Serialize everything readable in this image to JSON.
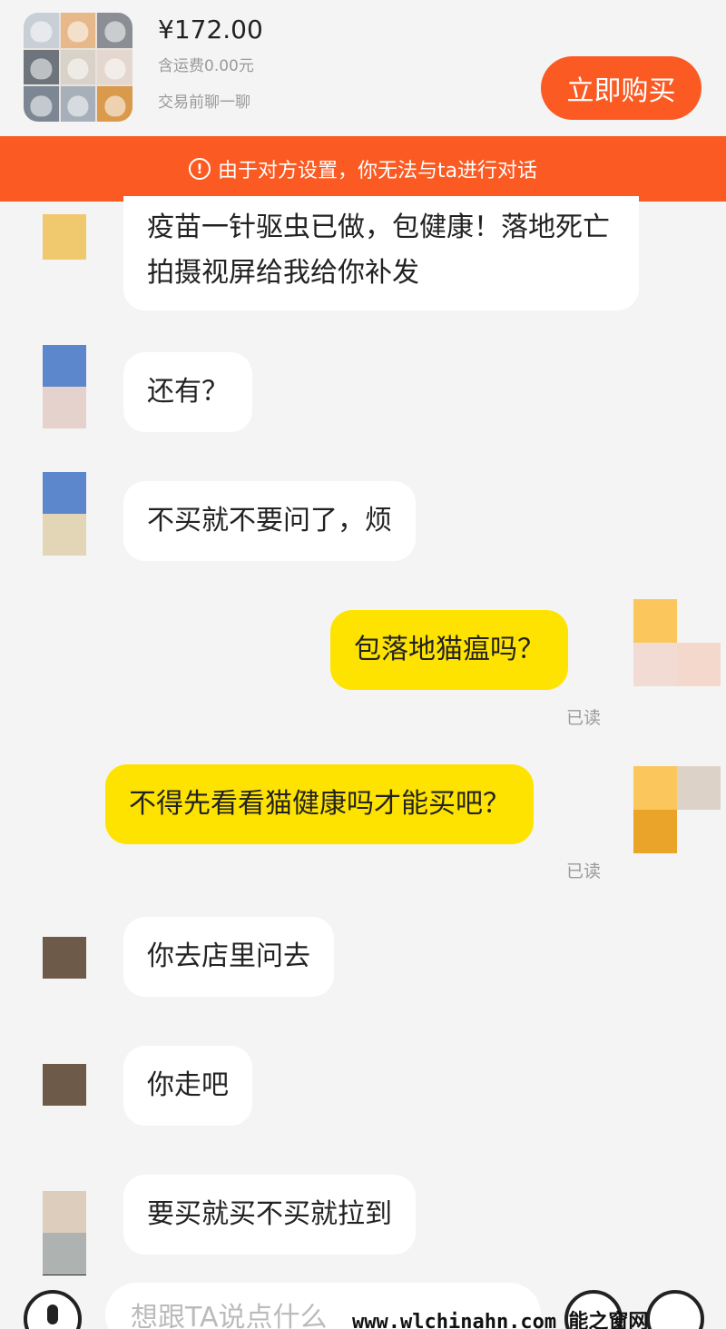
{
  "header": {
    "price": "¥172.00",
    "shipping": "含运费0.00元",
    "chat_note": "交易前聊一聊",
    "buy_label": "立即购买"
  },
  "banner": {
    "icon": "!",
    "text": "由于对方设置，你无法与ta进行对话"
  },
  "messages": [
    {
      "side": "left",
      "text": "疫苗一针驱虫已做，包健康！落地死亡拍摄视屏给我给你补发"
    },
    {
      "side": "left",
      "text": "还有？"
    },
    {
      "side": "left",
      "text": "不买就不要问了，烦"
    },
    {
      "side": "right",
      "text": "包落地猫瘟吗？",
      "status": "已读"
    },
    {
      "side": "right",
      "text": "不得先看看猫健康吗才能买吧？",
      "status": "已读"
    },
    {
      "side": "left",
      "text": "你去店里问去"
    },
    {
      "side": "left",
      "text": "你走吧"
    },
    {
      "side": "left",
      "text": "要买就买不买就拉到"
    }
  ],
  "input": {
    "placeholder": "想跟TA说点什么"
  },
  "watermark": "www.wlchinahn.com 能之窗网",
  "colors": {
    "accent": "#fb5a22",
    "own_bubble": "#ffe300",
    "other_bubble": "#ffffff",
    "background": "#f4f4f4"
  },
  "icons": [
    "warning-icon",
    "microphone-icon",
    "emoji-icon",
    "more-icon"
  ]
}
